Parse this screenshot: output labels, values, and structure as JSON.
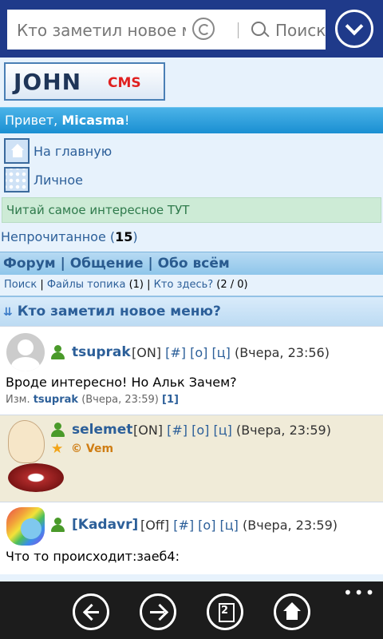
{
  "addressbar": {
    "url_text": "Кто заметил новое ме",
    "search_label": "Поиск"
  },
  "site": {
    "logo_main": "JOHN",
    "logo_sub": "CMS"
  },
  "greeting": {
    "prefix": "Привет, ",
    "user": "Micasma",
    "suffix": "!"
  },
  "menu": [
    {
      "label": "На главную",
      "icon": "home-icon"
    },
    {
      "label": "Личное",
      "icon": "grid-icon"
    }
  ],
  "notice": "Читай самое интересное ТУТ",
  "unread": {
    "label": "Непрочитанное",
    "open": " (",
    "count": "15",
    "close": ")"
  },
  "breadcrumb": {
    "text": "Форум | Общение | Обо всём"
  },
  "subnav": {
    "search": "Поиск",
    "sep1": " | ",
    "files": "Файлы топика",
    "files_count": " (1) | ",
    "who": "Кто здесь?",
    "who_count": " (2 / 0)"
  },
  "topic": {
    "arrows": "⇊",
    "title": "Кто заметил новое меню?"
  },
  "posts": [
    {
      "user": "tsuprak",
      "status": "[ON]",
      "links": "[#] [о] [ц]",
      "time": "(Вчера, 23:56)",
      "text": "Вроде интересно! Но Альк Зачем?",
      "edit_prefix": "Изм. ",
      "edit_user": "tsuprak",
      "edit_time": " (Вчера, 23:59) ",
      "edit_count": "[1]"
    },
    {
      "user": "selemet",
      "status": "[ON]",
      "links": "[#] [о] [ц]",
      "time": "(Вчера, 23:59)",
      "badge": "© Vem"
    },
    {
      "user": "[Kadavr]",
      "status": "[Off]",
      "links": "[#] [о] [ц]",
      "time": "(Вчера, 23:59)",
      "text": "Что то происходит:заеб4:"
    }
  ],
  "appbar": {
    "tabs_count": "2",
    "more": "•••"
  }
}
